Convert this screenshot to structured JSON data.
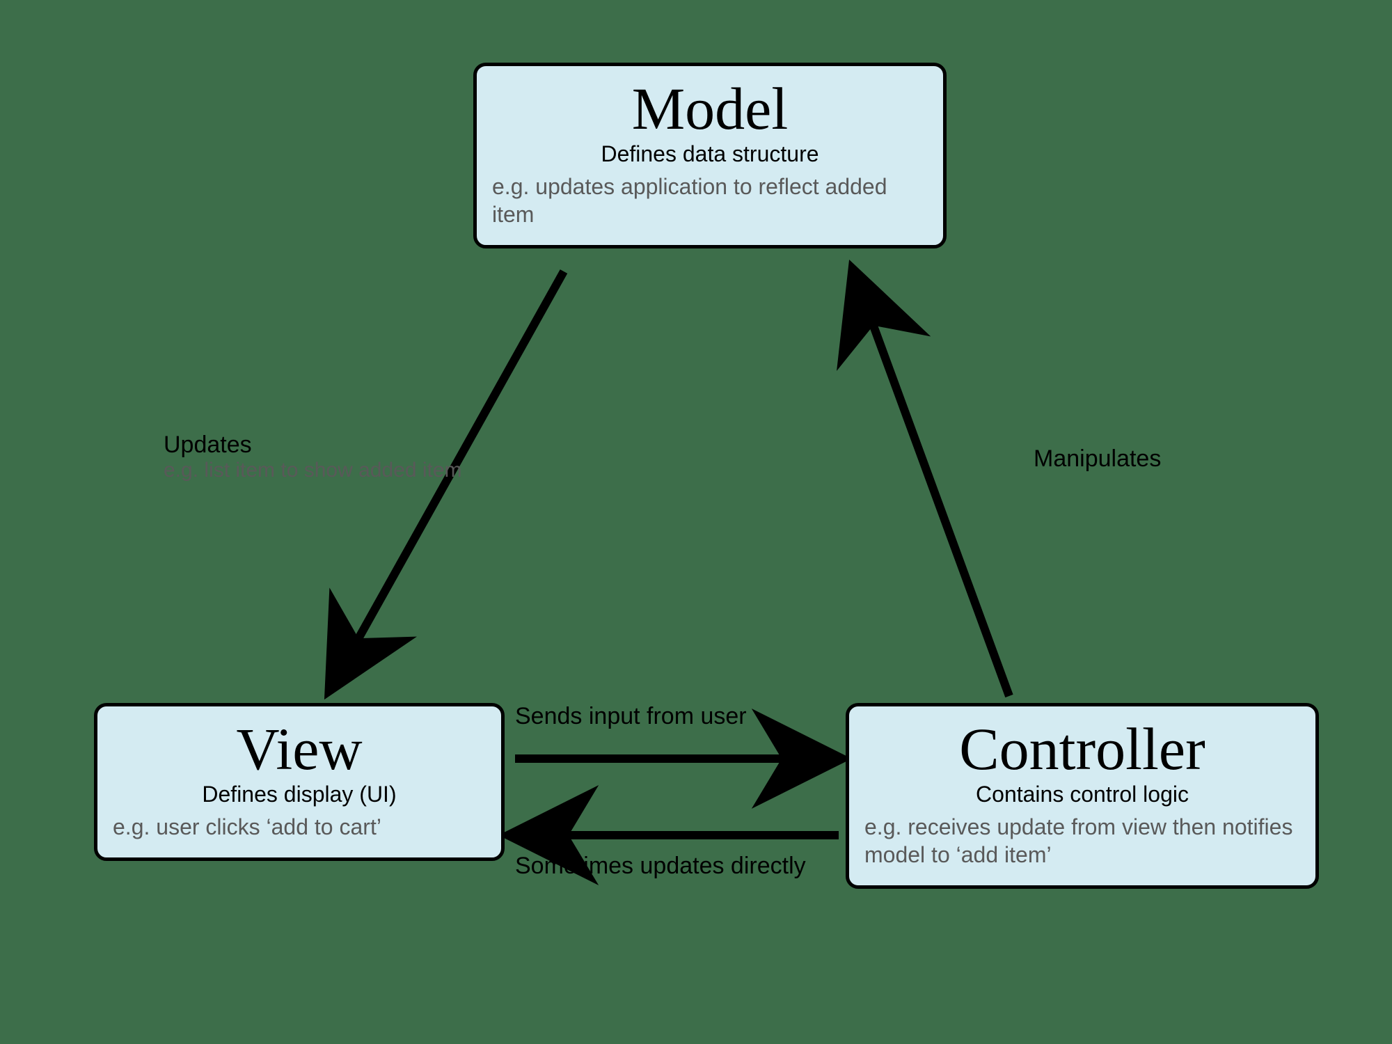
{
  "nodes": {
    "model": {
      "title": "Model",
      "subtitle": "Defines data structure",
      "example": "e.g. updates application to reflect added item"
    },
    "view": {
      "title": "View",
      "subtitle": "Defines display (UI)",
      "example": "e.g. user clicks ‘add to cart’"
    },
    "controller": {
      "title": "Controller",
      "subtitle": "Contains control logic",
      "example": "e.g. receives update from view then notifies model to ‘add item’"
    }
  },
  "edges": {
    "model_to_view": {
      "label": "Updates",
      "sub": "e.g. list item to show added item"
    },
    "controller_to_model": {
      "label": "Manipulates"
    },
    "view_to_controller": {
      "label": "Sends input from user"
    },
    "controller_to_view": {
      "label": "Sometimes updates directly"
    }
  }
}
